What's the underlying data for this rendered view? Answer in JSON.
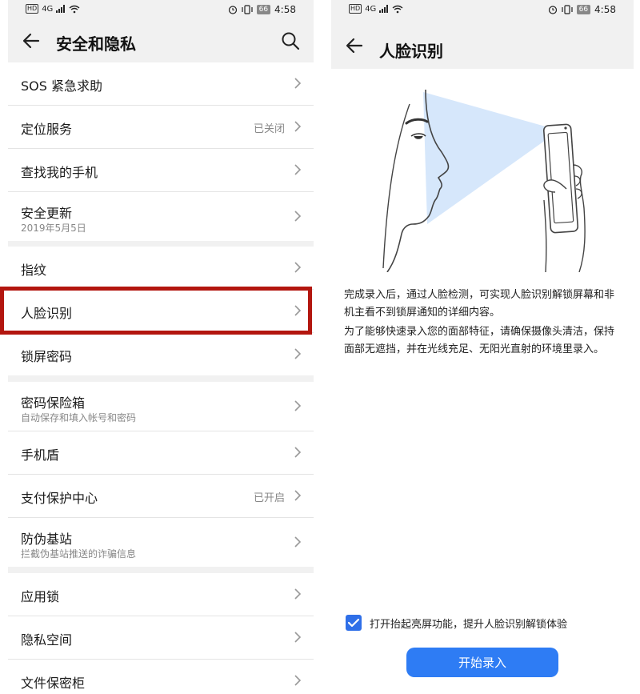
{
  "status_bar": {
    "net": "4G",
    "battery": "66",
    "time": "4:58"
  },
  "left": {
    "title": "安全和隐私",
    "groups": [
      {
        "items": [
          {
            "label": "SOS 紧急求助"
          },
          {
            "label": "定位服务",
            "value": "已关闭"
          },
          {
            "label": "查找我的手机"
          },
          {
            "label": "安全更新",
            "sub": "2019年5月5日"
          }
        ]
      },
      {
        "items": [
          {
            "label": "指纹"
          },
          {
            "label": "人脸识别"
          },
          {
            "label": "锁屏密码"
          }
        ]
      },
      {
        "items": [
          {
            "label": "密码保险箱",
            "sub": "自动保存和填入帐号和密码"
          },
          {
            "label": "手机盾"
          },
          {
            "label": "支付保护中心",
            "value": "已开启"
          },
          {
            "label": "防伪基站",
            "sub": "拦截伪基站推送的诈骗信息"
          }
        ]
      },
      {
        "items": [
          {
            "label": "应用锁"
          },
          {
            "label": "隐私空间"
          },
          {
            "label": "文件保密柜"
          }
        ]
      }
    ]
  },
  "right": {
    "title": "人脸识别",
    "desc1": "完成录入后，通过人脸检测，可实现人脸识别解锁屏幕和非机主看不到锁屏通知的详细内容。",
    "desc2": "为了能够快速录入您的面部特征，请确保摄像头清洁，保持面部无遮挡，并在光线充足、无阳光直射的环境里录入。",
    "checkbox_label": "打开抬起亮屏功能，提升人脸识别解锁体验",
    "checkbox_checked": true,
    "button_label": "开始录入"
  },
  "colors": {
    "accent": "#2e7cf4",
    "highlight": "#b3160f",
    "beam": "#d6e7fb"
  },
  "icons": [
    "back-arrow-icon",
    "search-icon",
    "chevron-right-icon",
    "checkmark-icon",
    "alarm-icon",
    "vibrate-icon",
    "wifi-icon",
    "signal-icon"
  ]
}
